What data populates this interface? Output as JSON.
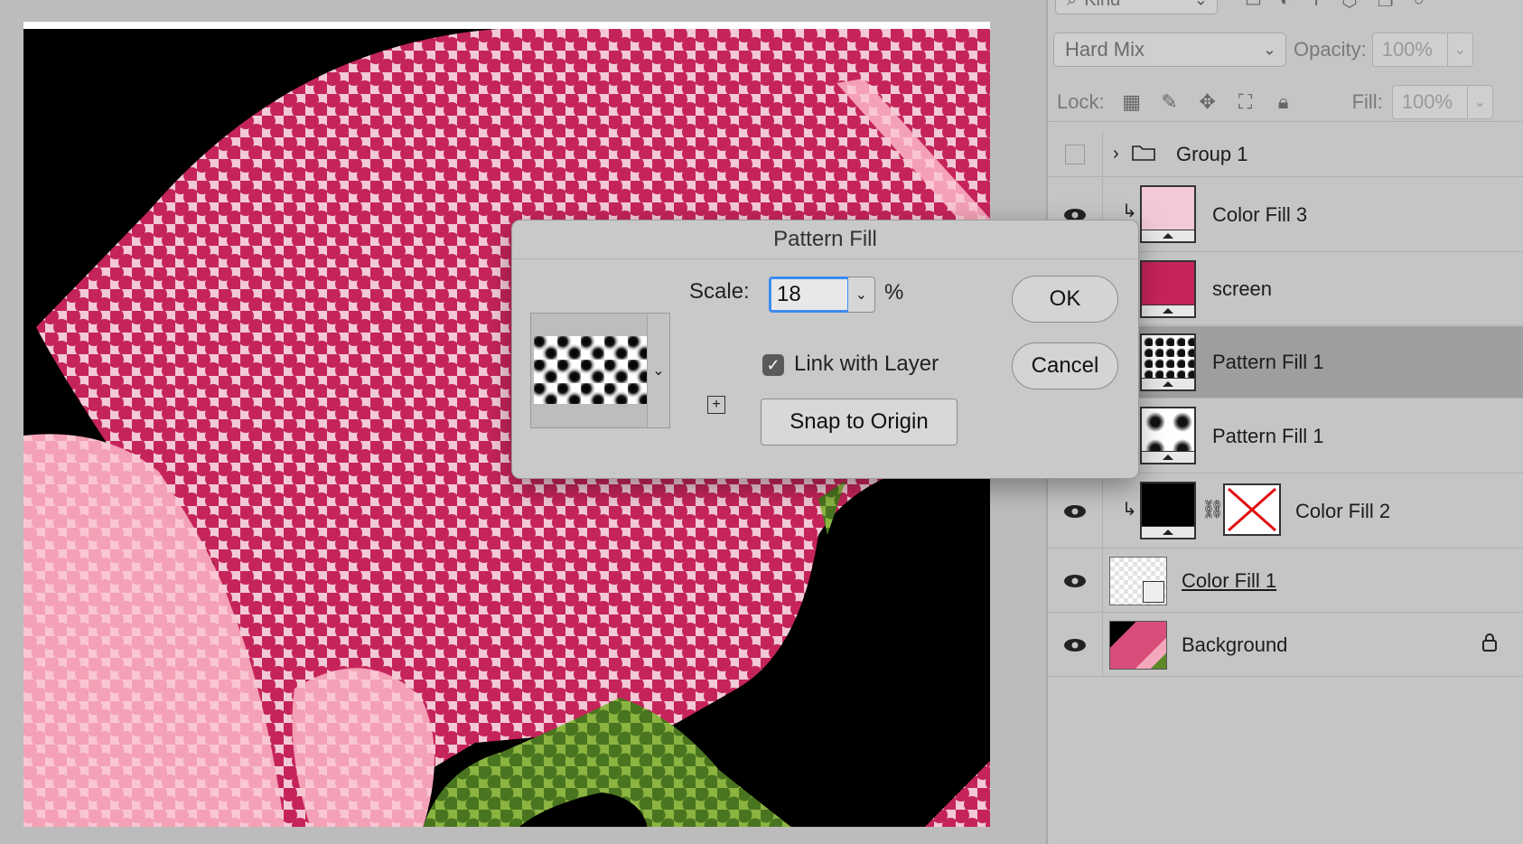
{
  "layers_panel": {
    "filter_label": "Kind",
    "blend_mode": "Hard Mix",
    "opacity_label": "Opacity:",
    "opacity_value": "100%",
    "lock_label": "Lock:",
    "fill_label": "Fill:",
    "fill_value": "100%",
    "layers": [
      {
        "name": "Group 1"
      },
      {
        "name": "Color Fill 3"
      },
      {
        "name": "screen"
      },
      {
        "name": "Pattern Fill 1"
      },
      {
        "name": "Pattern Fill 1"
      },
      {
        "name": "Color Fill 2"
      },
      {
        "name": "Color Fill 1"
      },
      {
        "name": "Background"
      }
    ]
  },
  "dialog": {
    "title": "Pattern Fill",
    "scale_label": "Scale:",
    "scale_value": "18",
    "scale_unit": "%",
    "link_label": "Link with Layer",
    "link_checked": true,
    "snap_label": "Snap to Origin",
    "ok_label": "OK",
    "cancel_label": "Cancel"
  },
  "colors": {
    "magenta": "#c5245a",
    "pale_pink": "#f2c9d5",
    "light_pink": "#f4a8bb",
    "green": "#5c8a2a",
    "selection_blue": "#3d8bf0"
  }
}
